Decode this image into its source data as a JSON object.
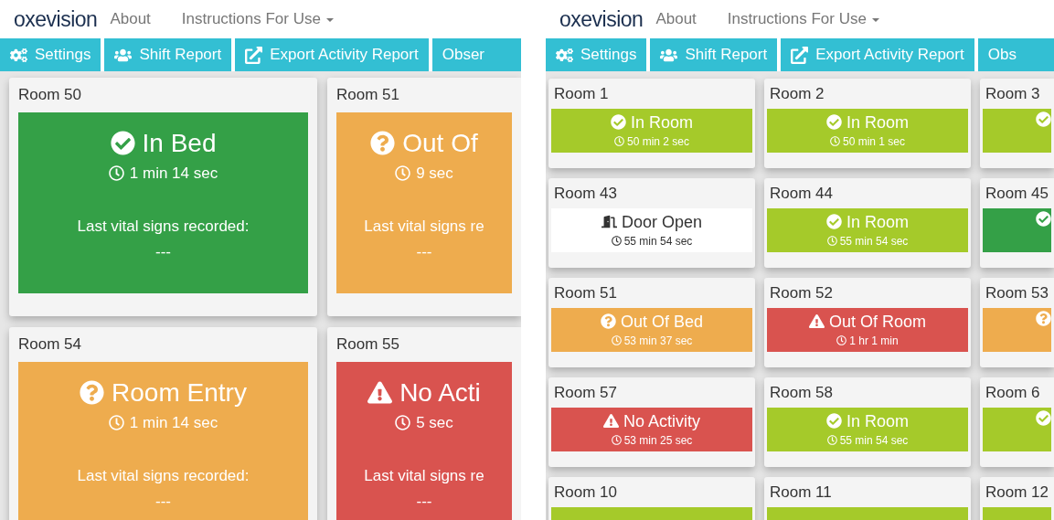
{
  "panels": [
    {
      "kind": "large",
      "logo": "oxevision",
      "nav": [
        {
          "label": "About",
          "dropdown": false
        },
        {
          "label": "Instructions For Use",
          "dropdown": true
        }
      ],
      "toolbar": [
        {
          "kind": "gears",
          "label": "Settings"
        },
        {
          "kind": "users",
          "label": "Shift Report"
        },
        {
          "kind": "export",
          "label": "Export Activity Report"
        },
        {
          "label": "Obser"
        }
      ],
      "rows": [
        [
          {
            "name": "Room 50",
            "status": {
              "kind": "check",
              "label": "In Bed",
              "time": "1 min 14 sec"
            },
            "color": "#34a047",
            "vitals_label": "Last vital signs recorded:",
            "vitals_value": "---"
          },
          {
            "name": "Room 51",
            "status": {
              "kind": "question",
              "label": "Out Of",
              "time": "9 sec"
            },
            "color": "#eeac4e",
            "vitals_label": "Last vital signs re",
            "vitals_value": "---"
          }
        ],
        [
          {
            "name": "Room 54",
            "status": {
              "kind": "question",
              "label": "Room Entry",
              "time": "1 min 14 sec"
            },
            "color": "#eeac4e",
            "vitals_label": "Last vital signs recorded:",
            "vitals_value": "---"
          },
          {
            "name": "Room 55",
            "status": {
              "kind": "warning",
              "label": "No Acti",
              "time": "5 sec"
            },
            "color": "#d9534f",
            "vitals_label": "Last vital signs re",
            "vitals_value": "---"
          }
        ]
      ]
    },
    {
      "kind": "compact",
      "logo": "oxevision",
      "nav": [
        {
          "label": "About",
          "dropdown": false
        },
        {
          "label": "Instructions For Use",
          "dropdown": true
        }
      ],
      "toolbar": [
        {
          "kind": "gears",
          "label": "Settings"
        },
        {
          "kind": "users",
          "label": "Shift Report"
        },
        {
          "kind": "export",
          "label": "Export Activity Report"
        },
        {
          "label": "Obs"
        }
      ],
      "rows": [
        [
          {
            "name": "Room 1",
            "status": {
              "kind": "check",
              "label": "In Room",
              "time": "50 min 2 sec"
            },
            "color": "#a5ca2a"
          },
          {
            "name": "Room 2",
            "status": {
              "kind": "check",
              "label": "In Room",
              "time": "50 min 1 sec"
            },
            "color": "#a5ca2a"
          },
          {
            "name": "Room 3",
            "status": {
              "kind": "check"
            },
            "color": "#a5ca2a"
          }
        ],
        [
          {
            "name": "Room 43",
            "status": {
              "kind": "door",
              "label": "Door Open",
              "time": "55 min 54 sec"
            },
            "color": "#ffffff"
          },
          {
            "name": "Room 44",
            "status": {
              "kind": "check",
              "label": "In Room",
              "time": "55 min 54 sec"
            },
            "color": "#a5ca2a"
          },
          {
            "name": "Room 45",
            "status": {
              "kind": "check"
            },
            "color": "#34a047"
          }
        ],
        [
          {
            "name": "Room 51",
            "status": {
              "kind": "question",
              "label": "Out Of Bed",
              "time": "53 min 37 sec"
            },
            "color": "#eeac4e"
          },
          {
            "name": "Room 52",
            "status": {
              "kind": "warning",
              "label": "Out Of Room",
              "time": "1 hr 1 min"
            },
            "color": "#d9534f"
          },
          {
            "name": "Room 53",
            "status": {
              "kind": "question"
            },
            "color": "#eeac4e"
          }
        ],
        [
          {
            "name": "Room 57",
            "status": {
              "kind": "warning",
              "label": "No Activity",
              "time": "53 min 25 sec"
            },
            "color": "#d9534f"
          },
          {
            "name": "Room 58",
            "status": {
              "kind": "check",
              "label": "In Room",
              "time": "55 min 54 sec"
            },
            "color": "#a5ca2a"
          },
          {
            "name": "Room 6",
            "status": {
              "kind": "check"
            },
            "color": "#a5ca2a"
          }
        ],
        [
          {
            "name": "Room 10",
            "color": "#a5ca2a"
          },
          {
            "name": "Room 11",
            "color": "#a5ca2a"
          },
          {
            "name": "Room 12",
            "color": "#a5ca2a"
          }
        ]
      ]
    }
  ]
}
